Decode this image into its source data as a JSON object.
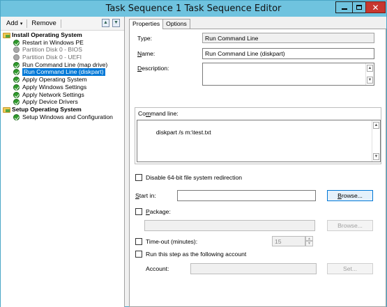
{
  "window": {
    "title": "Task Sequence 1 Task Sequence Editor",
    "minimize_icon": "minimize-icon",
    "maximize_icon": "maximize-icon",
    "close_icon": "close-icon",
    "close_glyph": "✕",
    "titlebar_color": "#6fc3df",
    "close_color": "#c7372f"
  },
  "toolbar": {
    "add_label": "Add",
    "remove_label": "Remove",
    "caret": "▾",
    "icons": [
      "move-up-icon",
      "move-down-icon"
    ]
  },
  "tree": {
    "items": [
      {
        "label": "Install Operating System",
        "icon": "folder-icon",
        "level": 0,
        "state": "group"
      },
      {
        "label": "Restart in Windows PE",
        "icon": "check-icon",
        "level": 1,
        "state": "enabled"
      },
      {
        "label": "Partition Disk 0 - BIOS",
        "icon": "disabled-icon",
        "level": 1,
        "state": "disabled"
      },
      {
        "label": "Partition Disk 0 - UEFI",
        "icon": "disabled-icon",
        "level": 1,
        "state": "disabled"
      },
      {
        "label": "Run Command Line (map drive)",
        "icon": "check-icon",
        "level": 1,
        "state": "enabled"
      },
      {
        "label": "Run Command Line (diskpart)",
        "icon": "check-icon",
        "level": 1,
        "state": "selected"
      },
      {
        "label": "Apply Operating System",
        "icon": "check-icon",
        "level": 1,
        "state": "enabled"
      },
      {
        "label": "Apply Windows Settings",
        "icon": "check-icon",
        "level": 1,
        "state": "enabled"
      },
      {
        "label": "Apply Network Settings",
        "icon": "check-icon",
        "level": 1,
        "state": "enabled"
      },
      {
        "label": "Apply Device Drivers",
        "icon": "check-icon",
        "level": 1,
        "state": "enabled"
      },
      {
        "label": "Setup Operating System",
        "icon": "folder-icon",
        "level": 0,
        "state": "group"
      },
      {
        "label": "Setup Windows and Configuration",
        "icon": "check-icon",
        "level": 1,
        "state": "enabled"
      }
    ]
  },
  "tabs": [
    {
      "label": "Properties",
      "active": true
    },
    {
      "label": "Options",
      "active": false
    }
  ],
  "properties": {
    "type_label": "Type:",
    "type_value": "Run Command Line",
    "name_label": "Name:",
    "name_value": "Run Command Line (diskpart)",
    "description_label": "Description:",
    "description_value": "",
    "command_line_label": "Command line:",
    "command_line_value": "diskpart /s m:\\test.txt",
    "disable_redirection_label": "Disable 64-bit file system redirection",
    "start_in_label": "Start in:",
    "start_in_value": "",
    "browse_label": "Browse...",
    "package_label": "Package:",
    "package_value": "",
    "browse2_label": "Browse...",
    "timeout_label": "Time-out (minutes):",
    "timeout_value": "15",
    "run_as_label": "Run this step as the following account",
    "account_label": "Account:",
    "account_value": "",
    "set_label": "Set..."
  }
}
